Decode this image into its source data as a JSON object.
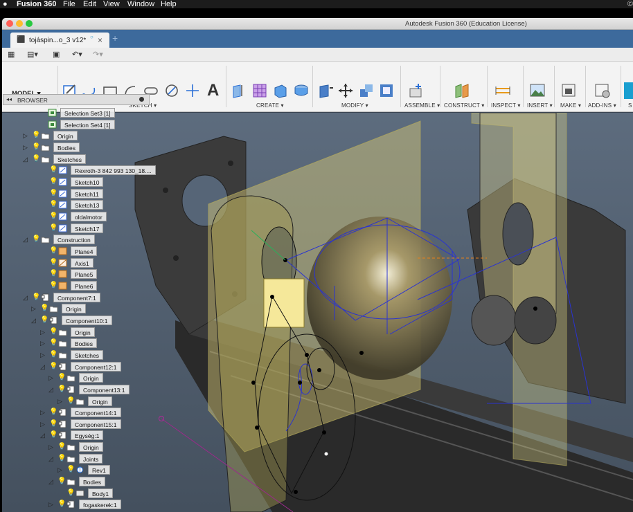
{
  "menubar": {
    "items": [
      "Fusion 360",
      "File",
      "Edit",
      "View",
      "Window",
      "Help"
    ]
  },
  "window": {
    "title": "Autodesk Fusion 360 (Education License)"
  },
  "tab": {
    "label": "tojáspin...o_3 v12*",
    "close": "×",
    "new": "+"
  },
  "ribbon": {
    "workspace": "MODEL ▾",
    "groups": [
      "SKETCH ▾",
      "CREATE ▾",
      "MODIFY ▾",
      "ASSEMBLE ▾",
      "CONSTRUCT ▾",
      "INSPECT ▾",
      "INSERT ▾",
      "MAKE ▾",
      "ADD-INS ▾",
      "S"
    ],
    "text_tool": "A"
  },
  "browser": {
    "title": "BROWSER",
    "items": [
      {
        "label": "Selection Set3 [1]",
        "depth": 0,
        "icon": "selection"
      },
      {
        "label": "Selection Set4 [1]",
        "depth": 0,
        "icon": "selection"
      },
      {
        "label": "Origin",
        "depth": 0,
        "icon": "folder",
        "tog": "▷",
        "bulb": true
      },
      {
        "label": "Bodies",
        "depth": 0,
        "icon": "folder",
        "tog": "▷",
        "bulb": true
      },
      {
        "label": "Sketches",
        "depth": 0,
        "icon": "folder",
        "tog": "◿",
        "bulb": true
      },
      {
        "label": "Rexroth-3 842 993 130_18....",
        "depth": 1,
        "icon": "sketch",
        "bulb": true
      },
      {
        "label": "Sketch10",
        "depth": 1,
        "icon": "sketch",
        "bulb": true
      },
      {
        "label": "Sketch11",
        "depth": 1,
        "icon": "sketch",
        "bulb": true
      },
      {
        "label": "Sketch13",
        "depth": 1,
        "icon": "sketch",
        "bulb": true
      },
      {
        "label": "oldalmotor",
        "depth": 1,
        "icon": "sketch",
        "bulb": true
      },
      {
        "label": "Sketch17",
        "depth": 1,
        "icon": "sketch",
        "bulb": true
      },
      {
        "label": "Construction",
        "depth": 0,
        "icon": "folder",
        "tog": "◿",
        "bulb": true
      },
      {
        "label": "Plane4",
        "depth": 1,
        "icon": "plane",
        "bulb": true
      },
      {
        "label": "Axis1",
        "depth": 1,
        "icon": "axis",
        "bulb": true
      },
      {
        "label": "Plane5",
        "depth": 1,
        "icon": "plane",
        "bulb": true
      },
      {
        "label": "Plane6",
        "depth": 1,
        "icon": "plane",
        "bulb": true
      },
      {
        "label": "Component7:1",
        "depth": 0,
        "icon": "component",
        "tog": "◿",
        "bulb": true
      },
      {
        "label": "Origin",
        "depth": 1,
        "icon": "folder",
        "tog": "▷",
        "bulb": true
      },
      {
        "label": "Component10:1",
        "depth": 1,
        "icon": "component",
        "tog": "◿",
        "bulb": true
      },
      {
        "label": "Origin",
        "depth": 2,
        "icon": "folder",
        "tog": "▷",
        "bulb": true
      },
      {
        "label": "Bodies",
        "depth": 2,
        "icon": "folder",
        "tog": "▷",
        "bulb": true
      },
      {
        "label": "Sketches",
        "depth": 2,
        "icon": "folder",
        "tog": "▷",
        "bulb": true
      },
      {
        "label": "Component12:1",
        "depth": 2,
        "icon": "component",
        "tog": "◿",
        "bulb": true
      },
      {
        "label": "Origin",
        "depth": 3,
        "icon": "folder",
        "tog": "▷",
        "bulb": true
      },
      {
        "label": "Component13:1",
        "depth": 3,
        "icon": "component",
        "tog": "◿",
        "bulb": true
      },
      {
        "label": "Origin",
        "depth": 4,
        "icon": "folder",
        "tog": "▷",
        "bulb": true
      },
      {
        "label": "Component14:1",
        "depth": 2,
        "icon": "component",
        "tog": "▷",
        "bulb": true
      },
      {
        "label": "Component15:1",
        "depth": 2,
        "icon": "component",
        "tog": "▷",
        "bulb": true
      },
      {
        "label": "Egység:1",
        "depth": 2,
        "icon": "component",
        "tog": "◿",
        "bulb": true
      },
      {
        "label": "Origin",
        "depth": 3,
        "icon": "folder",
        "tog": "▷",
        "bulb": true
      },
      {
        "label": "Joints",
        "depth": 3,
        "icon": "folder",
        "tog": "◿",
        "bulb": true
      },
      {
        "label": "Rev1",
        "depth": 4,
        "icon": "joint",
        "tog": "▷",
        "bulb": true
      },
      {
        "label": "Bodies",
        "depth": 3,
        "icon": "folder",
        "tog": "◿",
        "bulb": true
      },
      {
        "label": "Body1",
        "depth": 4,
        "icon": "body",
        "bulb": true
      },
      {
        "label": "fogaskerek:1",
        "depth": 2,
        "icon": "component",
        "tog": "▷",
        "bulb": true
      }
    ]
  },
  "colors": {
    "tabbar": "#3d6a9c",
    "plane": "#d8cf7a",
    "sketch": "#2a33d0",
    "body": "#3a3a3a"
  }
}
